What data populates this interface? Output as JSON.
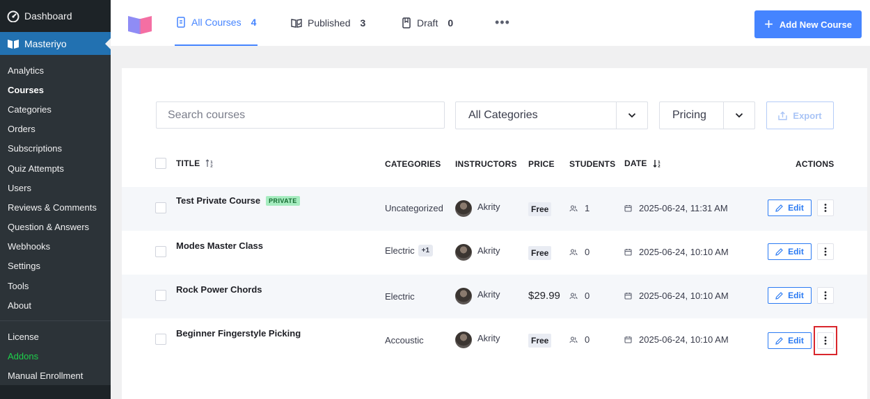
{
  "sidebar": {
    "dashboard": "Dashboard",
    "masteriyo": "Masteriyo",
    "submenu": [
      "Analytics",
      "Courses",
      "Categories",
      "Orders",
      "Subscriptions",
      "Quiz Attempts",
      "Users",
      "Reviews & Comments",
      "Question & Answers",
      "Webhooks",
      "Settings",
      "Tools",
      "About"
    ],
    "current": "Courses",
    "bottom": [
      "License",
      "Addons",
      "Manual Enrollment"
    ]
  },
  "header": {
    "tabs": [
      {
        "label": "All Courses",
        "count": "4",
        "icon": "document-icon"
      },
      {
        "label": "Published",
        "count": "3",
        "icon": "book-open-icon"
      },
      {
        "label": "Draft",
        "count": "0",
        "icon": "draft-icon"
      }
    ],
    "more": "•••",
    "add_button": "Add New Course"
  },
  "filters": {
    "search_placeholder": "Search courses",
    "category": "All Categories",
    "pricing": "Pricing",
    "export": "Export"
  },
  "table": {
    "columns": {
      "title": "TITLE",
      "categories": "CATEGORIES",
      "instructors": "INSTRUCTORS",
      "price": "PRICE",
      "students": "STUDENTS",
      "date": "DATE",
      "actions": "ACTIONS"
    },
    "edit_label": "Edit",
    "rows": [
      {
        "title": "Test Private Course",
        "badge": "PRIVATE",
        "category": "Uncategorized",
        "extra": "",
        "instructor": "Akrity",
        "price": "Free",
        "students": "1",
        "date": "2025-06-24, 11:31 AM"
      },
      {
        "title": "Modes Master Class",
        "badge": "",
        "category": "Electric",
        "extra": "+1",
        "instructor": "Akrity",
        "price": "Free",
        "students": "0",
        "date": "2025-06-24, 10:10 AM"
      },
      {
        "title": "Rock Power Chords",
        "badge": "",
        "category": "Electric",
        "extra": "",
        "instructor": "Akrity",
        "price": "$29.99",
        "students": "0",
        "date": "2025-06-24, 10:10 AM"
      },
      {
        "title": "Beginner Fingerstyle Picking",
        "badge": "",
        "category": "Accoustic",
        "extra": "",
        "instructor": "Akrity",
        "price": "Free",
        "students": "0",
        "date": "2025-06-24, 10:10 AM"
      }
    ]
  },
  "colors": {
    "accent": "#4584ff",
    "sidebar_bg": "#1d2327",
    "sidebar_active": "#2271b1",
    "addons_green": "#1ed14b",
    "private_badge": "#a6ecc0",
    "highlight": "#d9262c"
  }
}
